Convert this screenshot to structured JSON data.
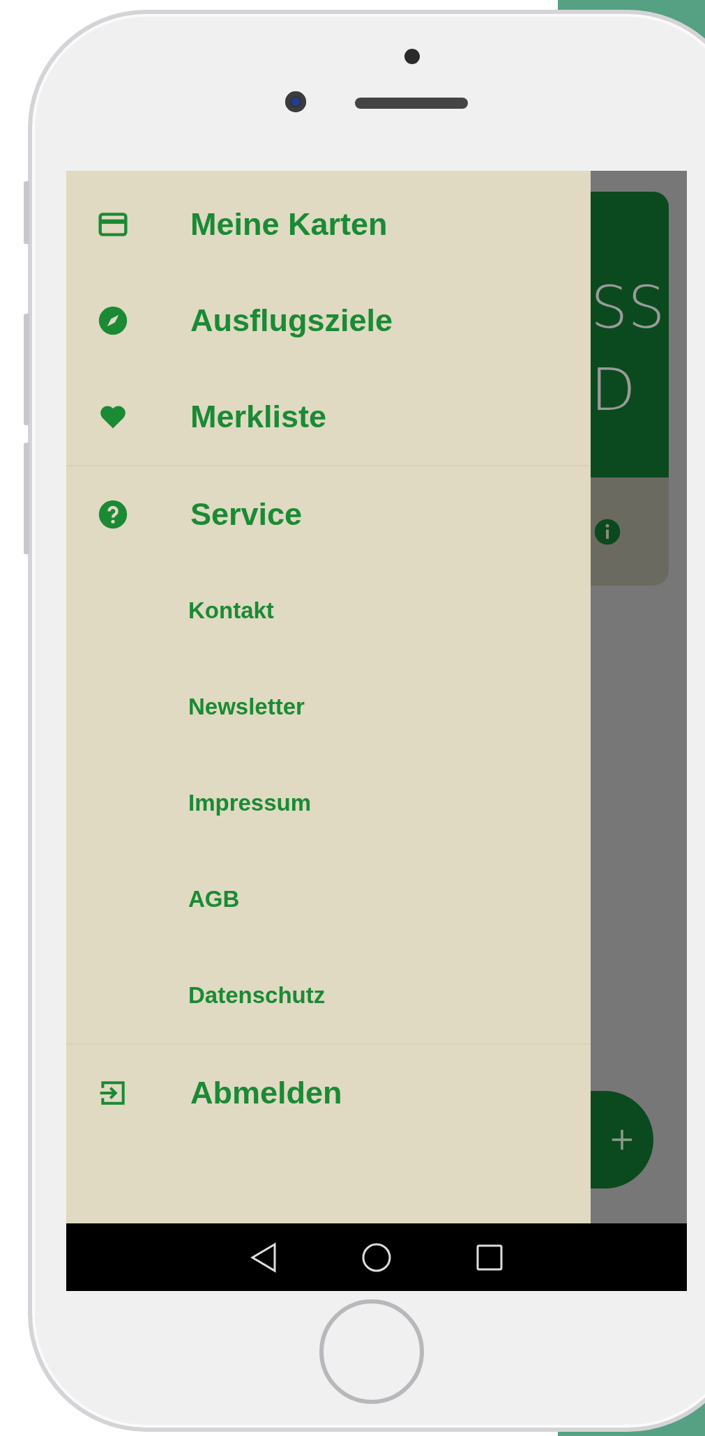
{
  "drawer": {
    "sections": [
      {
        "items": [
          {
            "label": "Meine Karten"
          },
          {
            "label": "Ausflugsziele"
          },
          {
            "label": "Merkliste"
          }
        ]
      },
      {
        "items": [
          {
            "label": "Service",
            "children": [
              {
                "label": "Kontakt"
              },
              {
                "label": "Newsletter"
              },
              {
                "label": "Impressum"
              },
              {
                "label": "AGB"
              },
              {
                "label": "Datenschutz"
              }
            ]
          }
        ]
      },
      {
        "items": [
          {
            "label": "Abmelden"
          }
        ]
      }
    ]
  },
  "background": {
    "card_title_lines": [
      "SS",
      "D"
    ]
  }
}
